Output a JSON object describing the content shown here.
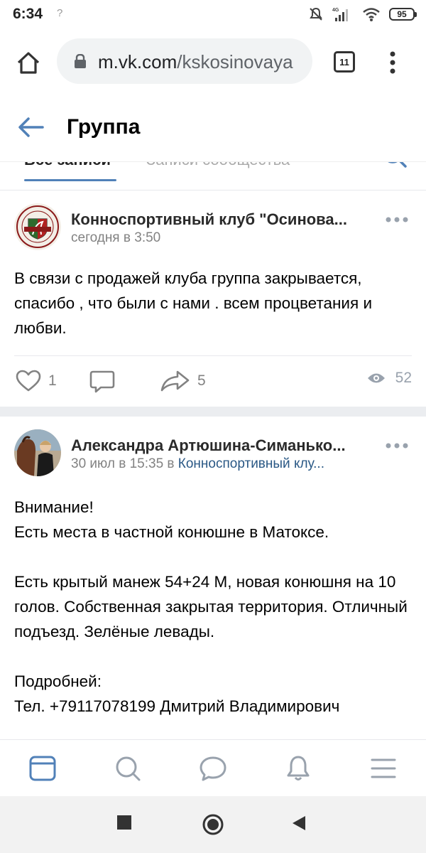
{
  "status_bar": {
    "time": "6:34",
    "signal_badge": "4G",
    "battery": "95",
    "icons": [
      "silent-icon",
      "signal-icon",
      "wifi-icon",
      "battery-icon"
    ]
  },
  "browser": {
    "url_domain": "m.vk.com",
    "url_path": "/kskosinovaya",
    "tab_count": "11"
  },
  "header": {
    "title": "Группа"
  },
  "tabs": {
    "items": [
      "Все записи",
      "Записи сообщества"
    ]
  },
  "posts": [
    {
      "author": "Конноспортивный клуб \"Осинова...",
      "time": "сегодня в 3:50",
      "text": "В связи с продажей клуба группа закрывается, спасибо , что были с нами . всем процветания и любви.",
      "likes": "1",
      "shares": "5",
      "views": "52"
    },
    {
      "author": "Александра Артюшина-Симанько...",
      "time": "30 июл в 15:35 в",
      "group": "Конноспортивный клу...",
      "text_lines": [
        "Внимание!",
        "Есть места в частной конюшне в Матоксе.",
        "",
        "Есть крытый манеж 54+24 М, новая конюшня на 10 голов. Собственная закрытая территория. Отличный подъезд. Зелёные левады.",
        "",
        "Подробней:",
        "Тел. +79117078199 Дмитрий Владимирович"
      ]
    }
  ],
  "colors": {
    "accent": "#5181b8",
    "link": "#2a5885",
    "meta": "#828282",
    "separator": "#ebedf0"
  }
}
